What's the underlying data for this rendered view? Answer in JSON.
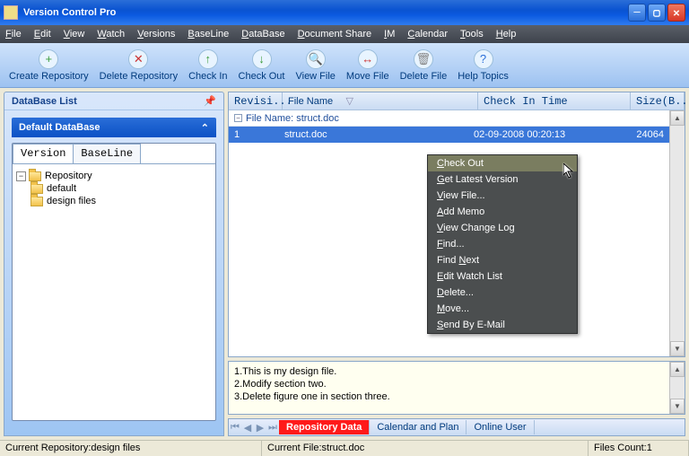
{
  "title": "Version Control Pro",
  "menu": [
    "File",
    "Edit",
    "View",
    "Watch",
    "Versions",
    "BaseLine",
    "DataBase",
    "Document Share",
    "IM",
    "Calendar",
    "Tools",
    "Help"
  ],
  "toolbar": [
    {
      "label": "Create Repository",
      "icon": "+"
    },
    {
      "label": "Delete Repository",
      "icon": "✕"
    },
    {
      "label": "Check In",
      "icon": "↑"
    },
    {
      "label": "Check Out",
      "icon": "↓"
    },
    {
      "label": "View File",
      "icon": "🔍"
    },
    {
      "label": "Move File",
      "icon": "↔"
    },
    {
      "label": "Delete File",
      "icon": "🗑"
    },
    {
      "label": "Help Topics",
      "icon": "?"
    }
  ],
  "sidebar": {
    "title": "DataBase List",
    "boxtitle": "Default DataBase",
    "tabs": [
      "Version",
      "BaseLine"
    ],
    "tree": {
      "root": "Repository",
      "children": [
        "default",
        "design files"
      ]
    }
  },
  "grid": {
    "cols": [
      "Revisi...",
      "File Name",
      "Check In Time",
      "Size(B..."
    ],
    "caption": "File Name: struct.doc",
    "row": {
      "rev": "1",
      "name": "struct.doc",
      "time": "02-09-2008 00:20:13",
      "size": "24064"
    }
  },
  "context": [
    "Check Out",
    "Get Latest Version",
    "View File...",
    "Add Memo",
    "View Change Log",
    "Find...",
    "Find Next",
    "Edit Watch List",
    "Delete...",
    "Move...",
    "Send By E-Mail"
  ],
  "memo": [
    "1.This is my design file.",
    "2.Modify section two.",
    "3.Delete figure one in section three."
  ],
  "bottomTabs": [
    "Repository Data",
    "Calendar and Plan",
    "Online User"
  ],
  "status": {
    "a": "Current Repository:design files",
    "b": "Current File:struct.doc",
    "c": "Files Count:1"
  }
}
